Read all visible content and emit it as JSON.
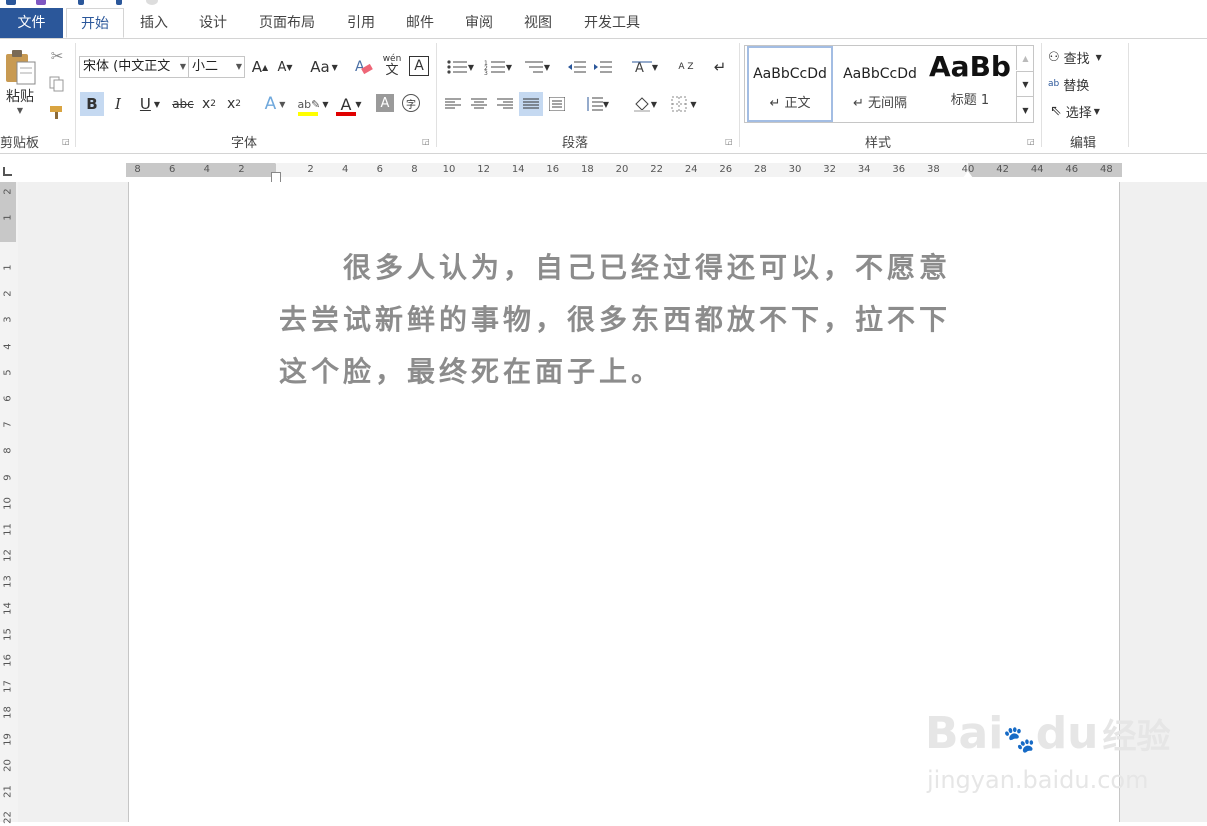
{
  "tabs": [
    "文件",
    "开始",
    "插入",
    "设计",
    "页面布局",
    "引用",
    "邮件",
    "审阅",
    "视图",
    "开发工具"
  ],
  "clipboard": {
    "paste_label": "粘贴",
    "group_label": "剪贴板"
  },
  "font": {
    "name_value": "宋体 (中文正文",
    "size_value": "小二",
    "grow_label": "A",
    "shrink_label": "A",
    "case_label": "Aa",
    "bold_label": "B",
    "italic_label": "I",
    "underline_label": "U",
    "strike_label": "abc",
    "subscript_label": "x",
    "subscript_sub": "2",
    "superscript_label": "x",
    "superscript_sup": "2",
    "effects_label": "A",
    "font_color_label": "A",
    "shading_label": "A",
    "phonetic_label": "wén",
    "phonetic_char": "文",
    "border_char_label": "A",
    "enclose_label": "字",
    "group_label": "字体",
    "highlight_color": "#ffff00",
    "font_color": "#e00000"
  },
  "paragraph": {
    "group_label": "段落",
    "sort_label": "A Z"
  },
  "styles": {
    "items": [
      {
        "preview": "AaBbCcDd",
        "name": "↵ 正文"
      },
      {
        "preview": "AaBbCcDd",
        "name": "↵ 无间隔"
      },
      {
        "preview": "AaBb",
        "name": "标题 1"
      }
    ],
    "group_label": "样式"
  },
  "editing": {
    "find_label": "查找",
    "replace_label": "替换",
    "select_label": "选择",
    "group_label": "编辑"
  },
  "ruler": {
    "left_ticks": [
      "8",
      "6",
      "4",
      "2"
    ],
    "right_ticks": [
      "2",
      "4",
      "6",
      "8",
      "10",
      "12",
      "14",
      "16",
      "18",
      "20",
      "22",
      "24",
      "26",
      "28",
      "30",
      "32",
      "34",
      "36",
      "38",
      "40",
      "42",
      "44",
      "46",
      "48"
    ],
    "vertical_ticks": [
      "2",
      "1",
      "1",
      "2",
      "3",
      "4",
      "5",
      "6",
      "7",
      "8",
      "9",
      "10",
      "11",
      "12",
      "13",
      "14",
      "15",
      "16",
      "17",
      "18",
      "19",
      "20",
      "21",
      "22"
    ]
  },
  "document": {
    "lines": [
      "　　很多人认为，自己已经过得还可以，不愿意",
      "去尝试新鲜的事物，很多东西都放不下，拉不下",
      "这个脸，最终死在面子上。"
    ]
  },
  "watermark": {
    "brand": "Bai",
    "brand2": "du",
    "product": "经验",
    "url": "jingyan.baidu.com"
  },
  "colors": {
    "accent": "#2b579a"
  }
}
